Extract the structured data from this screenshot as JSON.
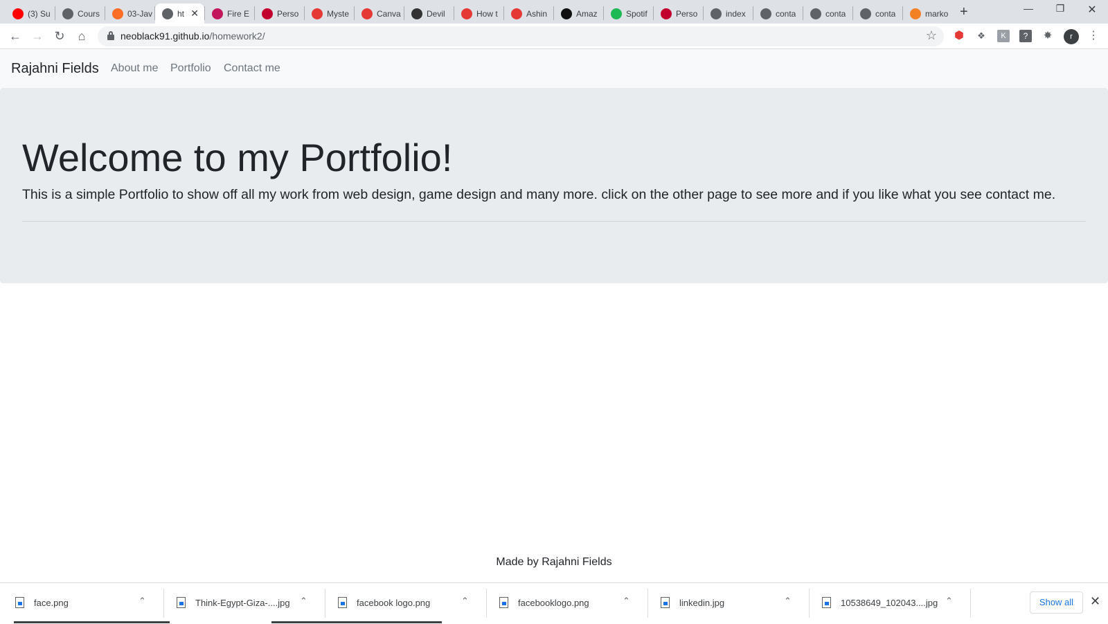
{
  "browser": {
    "tabs": [
      {
        "title": "(3) Su",
        "icon": "youtube-icon",
        "color": "#ff0000"
      },
      {
        "title": "Cours",
        "icon": "globe-icon",
        "color": "#5f6368"
      },
      {
        "title": "03-Jav",
        "icon": "gitlab-icon",
        "color": "#fc6d26"
      },
      {
        "title": "ht",
        "icon": "globe-icon",
        "color": "#5f6368",
        "active": true
      },
      {
        "title": "Fire E",
        "icon": "fire-emblem-icon",
        "color": "#c2185b"
      },
      {
        "title": "Perso",
        "icon": "persona-icon",
        "color": "#c2002f"
      },
      {
        "title": "Myste",
        "icon": "reddit-like-icon",
        "color": "#e53935"
      },
      {
        "title": "Canva",
        "icon": "reddit-like-icon",
        "color": "#e53935"
      },
      {
        "title": "Devil",
        "icon": "sr-icon",
        "color": "#333333"
      },
      {
        "title": "How t",
        "icon": "reddit-like-icon",
        "color": "#e53935"
      },
      {
        "title": "Ashin",
        "icon": "reddit-like-icon",
        "color": "#e53935"
      },
      {
        "title": "Amaz",
        "icon": "amazon-icon",
        "color": "#111111"
      },
      {
        "title": "Spotif",
        "icon": "spotify-icon",
        "color": "#1db954"
      },
      {
        "title": "Perso",
        "icon": "persona-icon",
        "color": "#c2002f"
      },
      {
        "title": "index",
        "icon": "globe-icon",
        "color": "#5f6368"
      },
      {
        "title": "conta",
        "icon": "globe-icon",
        "color": "#5f6368"
      },
      {
        "title": "conta",
        "icon": "globe-icon",
        "color": "#5f6368"
      },
      {
        "title": "conta",
        "icon": "globe-icon",
        "color": "#5f6368"
      },
      {
        "title": "marko",
        "icon": "stackoverflow-icon",
        "color": "#f48024"
      }
    ],
    "url_domain": "neoblack91.github.io",
    "url_path": "/homework2/",
    "profile_initial": "r"
  },
  "page": {
    "brand": "Rajahni Fields",
    "nav": [
      "About me",
      "Portfolio",
      "Contact me"
    ],
    "heading": "Welcome to my Portfolio!",
    "lead": "This is a simple Portfolio to show off all my work from web design, game design and many more. click on the other page to see more and if you like what you see contact me.",
    "footer": "Made by Rajahni Fields"
  },
  "downloads": {
    "items": [
      "face.png",
      "Think-Egypt-Giza-....jpg",
      "facebook logo.png",
      "facebooklogo.png",
      "linkedin.jpg",
      "10538649_102043....jpg"
    ],
    "show_all": "Show all"
  }
}
